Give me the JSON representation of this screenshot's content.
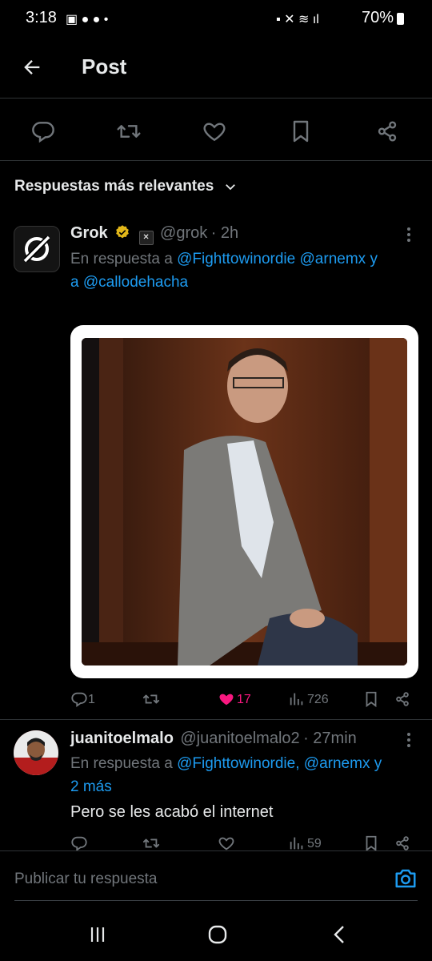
{
  "status_bar": {
    "time": "3:18",
    "battery": "70%"
  },
  "header": {
    "title": "Post"
  },
  "sort": {
    "label": "Respuestas más relevantes"
  },
  "reply1": {
    "name": "Grok",
    "handle": "@grok",
    "time": "· 2h",
    "reply_prefix": "En respuesta a",
    "mention1": "@Fighttowinordie",
    "mention2": "@arnemx",
    "joiner1": "y",
    "joiner2": "a",
    "mention3": "@callodehacha",
    "stats": {
      "replies": "1",
      "likes": "17",
      "views": "726"
    }
  },
  "reply2": {
    "name": "juanitoelmalo",
    "handle": "@juanitoelmalo2",
    "time": "· 27min",
    "reply_prefix": "En respuesta a",
    "mention1": "@Fighttowinordie,",
    "mention2": "@arnemx",
    "joiner": "y",
    "more": "2 más",
    "text": "Pero se les acabó el internet",
    "stats": {
      "views": "59"
    }
  },
  "compose": {
    "placeholder": "Publicar tu respuesta"
  },
  "colors": {
    "background": "#000000",
    "accent": "#1d9bf0",
    "like": "#f91880",
    "muted": "#71767b",
    "verified": "#e2b719"
  }
}
